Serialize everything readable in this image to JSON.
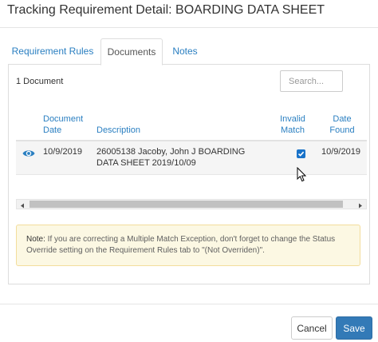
{
  "modal": {
    "title": "Tracking Requirement Detail: BOARDING DATA SHEET"
  },
  "tabs": [
    {
      "label": "Requirement Rules",
      "active": false
    },
    {
      "label": "Documents",
      "active": true
    },
    {
      "label": "Notes",
      "active": false
    }
  ],
  "documents": {
    "count_label": "1 Document",
    "search": {
      "placeholder": "Search...",
      "value": ""
    },
    "columns": {
      "document_date": "Document Date",
      "description": "Description",
      "invalid_match": "Invalid Match",
      "date_found": "Date Found"
    },
    "rows": [
      {
        "icon": "eye-icon",
        "document_date": "10/9/2019",
        "description": "26005138 Jacoby, John J BOARDING DATA SHEET 2019/10/09",
        "invalid_match": true,
        "date_found": "10/9/2019"
      }
    ]
  },
  "note": {
    "label": "Note:",
    "text": " If you are correcting a Multiple Match Exception, don't forget to change the Status Override setting on the Requirement Rules tab to \"(Not Overriden)\"."
  },
  "footer": {
    "cancel_label": "Cancel",
    "save_label": "Save"
  },
  "colors": {
    "accent": "#2a7fc1",
    "primary_button": "#337ab7",
    "note_background": "#fcf8e3",
    "checkbox": "#1a73c9"
  }
}
